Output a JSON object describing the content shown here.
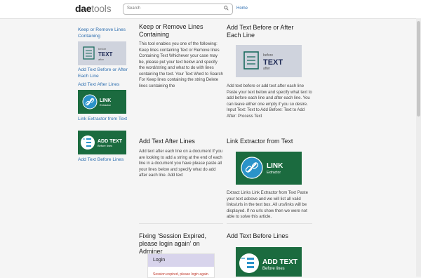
{
  "header": {
    "logo_main": "dae",
    "logo_sub": "tools",
    "search_placeholder": "Search",
    "home_label": "Home"
  },
  "sidebar": {
    "items": [
      {
        "label": "Keep or Remove Lines Containing"
      },
      {
        "label": "Add Text Before or After Each Line"
      },
      {
        "label": "Add Text After Lines"
      },
      {
        "label": "Link Extractor from Text"
      },
      {
        "label": "Add Text Before Lines"
      }
    ]
  },
  "thumbs": {
    "before_after": {
      "small": "before",
      "big": "TEXT",
      "small2": "after"
    },
    "link_extractor": {
      "big": "LINK",
      "small": "Extractor"
    },
    "add_text_before": {
      "big": "ADD TEXT",
      "small": "Before lines"
    }
  },
  "cards": {
    "keep_remove": {
      "title": "Keep or Remove Lines Containing",
      "desc": "This tool enables you one of the following: Keep lines containing Text or Remove lines Containing Text Whichever your case may be, please put your text below and specify the word/string and what to do with lines containing the text. Your Text Word to Search For Keep lines containing the string Delete lines containing the"
    },
    "add_before_after": {
      "title": "Add Text Before or After Each Line",
      "desc": "Add text before or add text after each line Paste your text below and specify what text to add before each line and after each line. You can leave either one empty if you so desire. Input Text: Text to Add Before: Text to Add After: Process Text"
    },
    "add_after": {
      "title": "Add Text After Lines",
      "desc": "Add text after each line on a document If you are looking to add a string at the end of each line in a document you have please paste all your lines below and specify what do add after each line. Add text"
    },
    "link_extractor": {
      "title": "Link Extractor from Text",
      "desc": "Extract Links   Link Extractor from Text Paste your text asbove and we will list all valid links/urls in the text box. All urs/links will be displayed. If no urls show then we were not able to solve this article."
    },
    "session_expired": {
      "title": "Fixing ‘Session Expired, please login again’ on Adminer",
      "login_title": "Login",
      "login_error": "Session expired, please login again."
    },
    "add_before": {
      "title": "Add Text Before Lines"
    }
  },
  "colors": {
    "link": "#2e6fb0",
    "teal_card": "#1b6b3f",
    "grey_card": "#cfd3dd"
  }
}
